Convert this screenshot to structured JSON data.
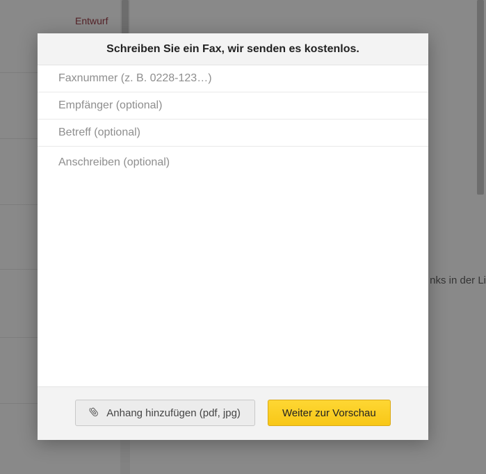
{
  "background": {
    "entwurf_label": "Entwurf",
    "right_text_fragment": "nks in der Li"
  },
  "modal": {
    "title": "Schreiben Sie ein Fax, wir senden es kostenlos.",
    "fax_number": {
      "value": "",
      "placeholder": "Faxnummer (z. B. 0228-123…)"
    },
    "recipient": {
      "value": "",
      "placeholder": "Empfänger (optional)"
    },
    "subject": {
      "value": "",
      "placeholder": "Betreff (optional)"
    },
    "cover_letter": {
      "value": "",
      "placeholder": "Anschreiben (optional)"
    },
    "footer": {
      "attach_label": "Anhang hinzufügen (pdf, jpg)",
      "attach_icon": "paperclip-icon",
      "continue_label": "Weiter zur Vorschau"
    }
  }
}
